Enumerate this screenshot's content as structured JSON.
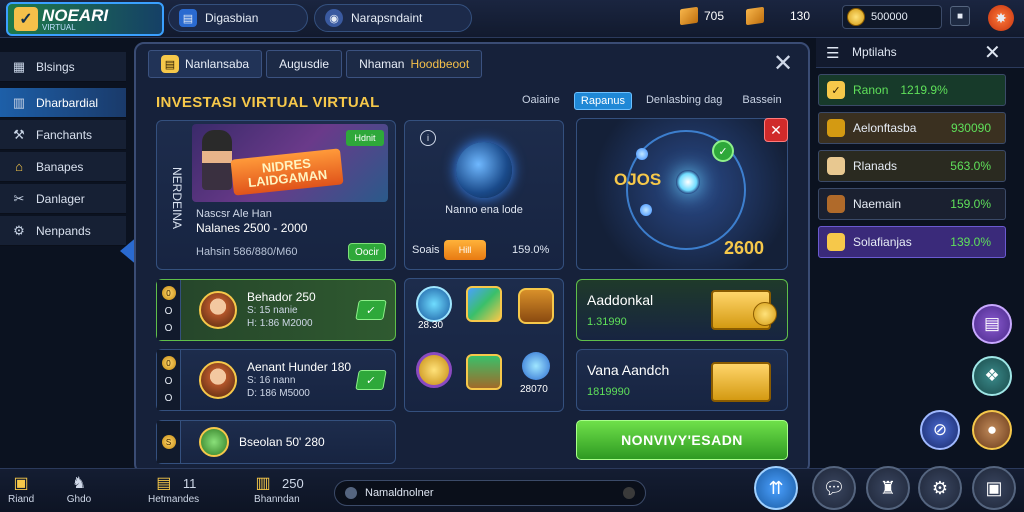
{
  "topbar": {
    "logo_title": "NOEARI",
    "logo_sub": "VIRTUAL",
    "tab1_label": "Digasbian",
    "tab2_label": "Narapsndaint",
    "res1_value": "705",
    "res2_value": "130",
    "gold_value": "500000",
    "icons": [
      "news-icon",
      "globe-icon",
      "crate-icon",
      "coin-icon",
      "fire-icon"
    ]
  },
  "sidebar": {
    "items": [
      {
        "label": "Blsings",
        "icon": "building-icon"
      },
      {
        "label": "Dharbardial",
        "icon": "chart-icon",
        "active": true
      },
      {
        "label": "Fanchants",
        "icon": "tools-icon"
      },
      {
        "label": "Banapes",
        "icon": "house-icon"
      },
      {
        "label": "Danlager",
        "icon": "wrench-icon"
      },
      {
        "label": "Nenpands",
        "icon": "gear-icon"
      }
    ]
  },
  "panel": {
    "tabs": [
      "Nanlansaba",
      "Augusdie",
      "Nhaman",
      "Hoodbeoot"
    ],
    "title": "INVESTASI VIRTUAL VIRTUAL",
    "filters": [
      "Oaiaine",
      "Rapanus",
      "Denlasbing dag",
      "Bassein"
    ],
    "feature": {
      "side_label": "NERDEINA",
      "banner_text": "NIDRES LAIDGAMAN",
      "badge": "Hdnit",
      "line1": "Nascsr Ale Han",
      "line2": "Nalanes 2500 - 2000",
      "line3": "Hahsin 586/880/M60",
      "button": "Oocir"
    },
    "globe": {
      "label": "Nanno ena lode",
      "stat_left": "Soais",
      "pill": "Hill",
      "stat_right": "159.0%"
    },
    "orbit": {
      "text": "OJOS",
      "number": "2600"
    },
    "agents": [
      {
        "num": "O O O",
        "title": "Behador 250",
        "sub1": "S: 15 nanie",
        "sub2": "H: 1:86 M2000",
        "green": true
      },
      {
        "num": "O O O",
        "title": "Aenant Hunder 180",
        "sub1": "S: 16 nann",
        "sub2": "D: 186 M5000",
        "green": false
      },
      {
        "num": "S",
        "title": "Bseolan 50' 280",
        "sub1": "",
        "sub2": "",
        "green": false
      }
    ],
    "items": {
      "top_label": "28.30",
      "bottom_label": "28070",
      "icons": [
        "blue-orb-icon",
        "map-icon",
        "barrel-icon",
        "medal-icon",
        "chest-icon",
        "feather-icon"
      ]
    },
    "rewards": [
      {
        "title": "Aaddonkal",
        "value": "1.31990",
        "green": true
      },
      {
        "title": "Vana Aandch",
        "value": "1819990",
        "green": false
      }
    ],
    "cta": "NONVIVY'ESADN"
  },
  "rpanel": {
    "title": "Mptilahs",
    "rows": [
      {
        "label": "Ranon",
        "value": "1219.9%",
        "bg": "#173a2a",
        "icon": "checkmark-icon",
        "label_color": "#5fe05a"
      },
      {
        "label": "Aelonftasba",
        "value": "930090",
        "bg": "#3a3020",
        "icon": "crate-icon",
        "label_color": "#ffffff"
      },
      {
        "label": "Rlanads",
        "value": "563.0%",
        "bg": "#2a2a20",
        "icon": "scroll-icon",
        "label_color": "#ffffff"
      },
      {
        "label": "Naemain",
        "value": "159.0%",
        "bg": "#1a2030",
        "icon": "anvil-icon",
        "label_color": "#ffffff"
      },
      {
        "label": "Solafianjas",
        "value": "139.0%",
        "bg": "#3a2a7a",
        "icon": "chest-icon",
        "label_color": "#ffffff"
      }
    ]
  },
  "bottombar": {
    "items": [
      {
        "label": "Riand",
        "icon": "chest-icon"
      },
      {
        "label": "Ghdo",
        "icon": "horse-icon"
      },
      {
        "label": "Hetmandes",
        "value": "11",
        "icon": "package-icon"
      },
      {
        "label": "Bhanndan",
        "value": "250",
        "icon": "bank-icon"
      }
    ],
    "chat_text": "Namaldnolner"
  }
}
